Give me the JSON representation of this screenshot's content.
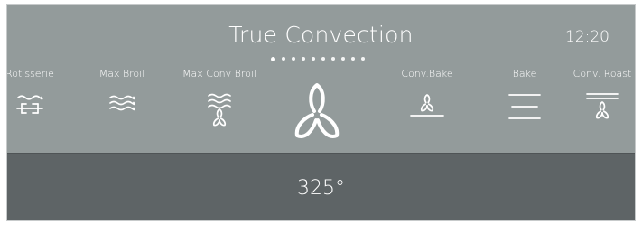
{
  "header": {
    "title": "True Convection",
    "clock": "12:20"
  },
  "pager": {
    "page_count": 10,
    "active_index": 0
  },
  "modes": [
    {
      "label": "Rotisserie",
      "icon": "rotisserie-icon"
    },
    {
      "label": "Max Broil",
      "icon": "max-broil-icon"
    },
    {
      "label": "Max Conv Broil",
      "icon": "max-conv-broil-icon"
    },
    {
      "label": "",
      "icon": "true-convection-fan-icon",
      "selected": true
    },
    {
      "label": "Conv.Bake",
      "icon": "conv-bake-icon"
    },
    {
      "label": "Bake",
      "icon": "bake-icon"
    },
    {
      "label": "Conv. Roast",
      "icon": "conv-roast-icon"
    }
  ],
  "temperature": {
    "value": "325°"
  },
  "colors": {
    "panel_upper": "#939b9b",
    "panel_lower": "#5e6466",
    "foreground": "#ffffff"
  }
}
